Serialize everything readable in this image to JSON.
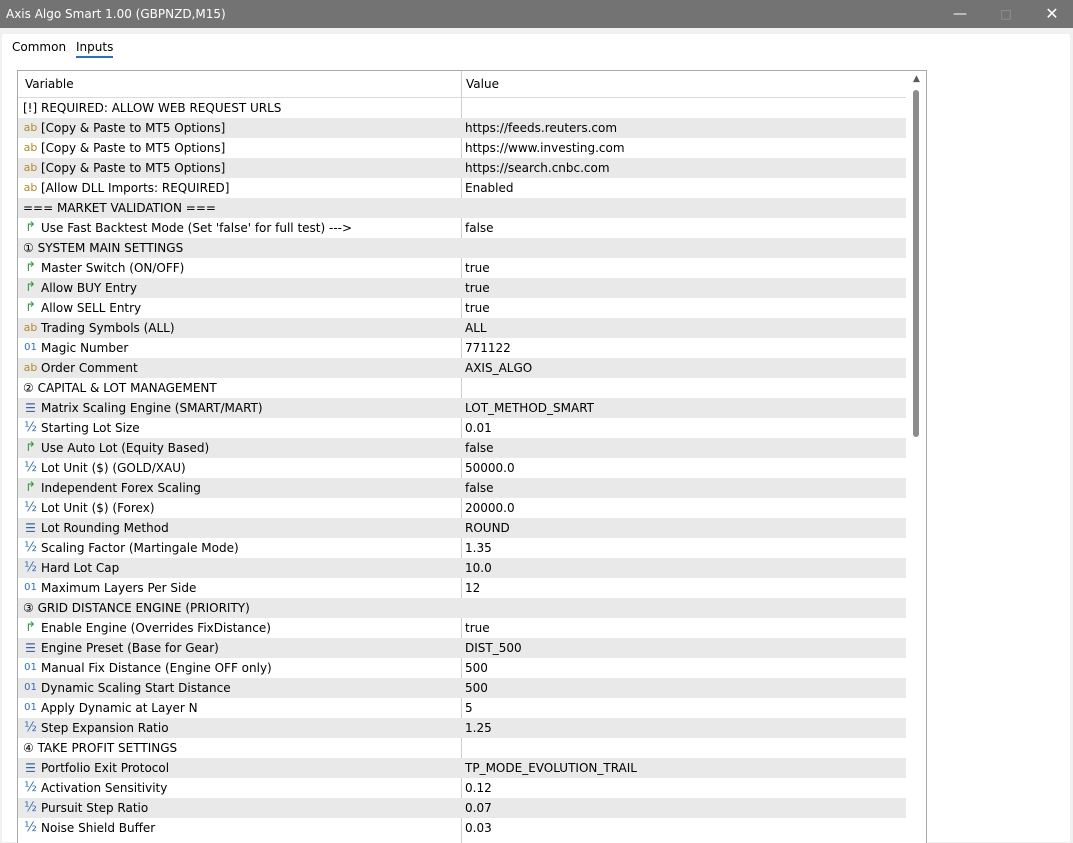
{
  "window": {
    "title": "Axis Algo Smart 1.00 (GBPNZD,M15)",
    "minimize": "—",
    "maximize": "□",
    "close": "✕"
  },
  "tabs": [
    {
      "label": "Common"
    },
    {
      "label": "Inputs"
    }
  ],
  "active_tab": "Inputs",
  "grid": {
    "headers": {
      "variable": "Variable",
      "value": "Value"
    },
    "rows": [
      {
        "icon": "none",
        "name": "[!] REQUIRED: ALLOW WEB REQUEST URLS",
        "value": ""
      },
      {
        "icon": "string",
        "name": "[Copy & Paste to MT5 Options]",
        "value": "https://feeds.reuters.com"
      },
      {
        "icon": "string",
        "name": "[Copy & Paste to MT5 Options]",
        "value": "https://www.investing.com"
      },
      {
        "icon": "string",
        "name": "[Copy & Paste to MT5 Options]",
        "value": "https://search.cnbc.com"
      },
      {
        "icon": "string",
        "name": "[Allow DLL Imports: REQUIRED]",
        "value": "Enabled"
      },
      {
        "icon": "none",
        "name": "=== MARKET VALIDATION ===",
        "value": ""
      },
      {
        "icon": "bool",
        "name": "Use Fast Backtest Mode (Set 'false' for full test) --->",
        "value": "false"
      },
      {
        "icon": "none",
        "name": "① SYSTEM MAIN SETTINGS",
        "value": ""
      },
      {
        "icon": "bool",
        "name": "Master Switch (ON/OFF)",
        "value": "true"
      },
      {
        "icon": "bool",
        "name": "Allow BUY Entry",
        "value": "true"
      },
      {
        "icon": "bool",
        "name": "Allow SELL Entry",
        "value": "true"
      },
      {
        "icon": "string",
        "name": "Trading Symbols (ALL)",
        "value": "ALL"
      },
      {
        "icon": "int",
        "name": "Magic Number",
        "value": "771122"
      },
      {
        "icon": "string",
        "name": "Order Comment",
        "value": "AXIS_ALGO"
      },
      {
        "icon": "none",
        "name": "② CAPITAL & LOT MANAGEMENT",
        "value": ""
      },
      {
        "icon": "enum",
        "name": "Matrix Scaling Engine (SMART/MART)",
        "value": "LOT_METHOD_SMART"
      },
      {
        "icon": "double",
        "name": "Starting Lot Size",
        "value": "0.01"
      },
      {
        "icon": "bool",
        "name": "Use Auto Lot (Equity Based)",
        "value": "false"
      },
      {
        "icon": "double",
        "name": "Lot Unit ($) (GOLD/XAU)",
        "value": "50000.0"
      },
      {
        "icon": "bool",
        "name": "Independent Forex Scaling",
        "value": "false"
      },
      {
        "icon": "double",
        "name": "Lot Unit ($) (Forex)",
        "value": "20000.0"
      },
      {
        "icon": "enum",
        "name": "Lot Rounding Method",
        "value": "ROUND"
      },
      {
        "icon": "double",
        "name": "Scaling Factor (Martingale Mode)",
        "value": "1.35"
      },
      {
        "icon": "double",
        "name": "Hard Lot Cap",
        "value": "10.0"
      },
      {
        "icon": "int",
        "name": "Maximum Layers Per Side",
        "value": "12"
      },
      {
        "icon": "none",
        "name": "③ GRID DISTANCE ENGINE (PRIORITY)",
        "value": ""
      },
      {
        "icon": "bool",
        "name": "Enable Engine (Overrides FixDistance)",
        "value": "true"
      },
      {
        "icon": "enum",
        "name": "Engine Preset (Base for Gear)",
        "value": "DIST_500"
      },
      {
        "icon": "int",
        "name": "Manual Fix Distance (Engine OFF only)",
        "value": "500"
      },
      {
        "icon": "int",
        "name": "Dynamic Scaling Start Distance",
        "value": "500"
      },
      {
        "icon": "int",
        "name": "Apply Dynamic at Layer N",
        "value": "5"
      },
      {
        "icon": "double",
        "name": "Step Expansion Ratio",
        "value": "1.25"
      },
      {
        "icon": "none",
        "name": "④ TAKE PROFIT SETTINGS",
        "value": ""
      },
      {
        "icon": "enum",
        "name": "Portfolio Exit Protocol",
        "value": "TP_MODE_EVOLUTION_TRAIL"
      },
      {
        "icon": "double",
        "name": "Activation Sensitivity",
        "value": "0.12"
      },
      {
        "icon": "double",
        "name": "Pursuit Step Ratio",
        "value": "0.07"
      },
      {
        "icon": "double",
        "name": "Noise Shield Buffer",
        "value": "0.03"
      }
    ]
  },
  "icon_legend": {
    "string": "ab",
    "bool": "↱",
    "int": "01",
    "double": "½",
    "enum": "☰"
  }
}
